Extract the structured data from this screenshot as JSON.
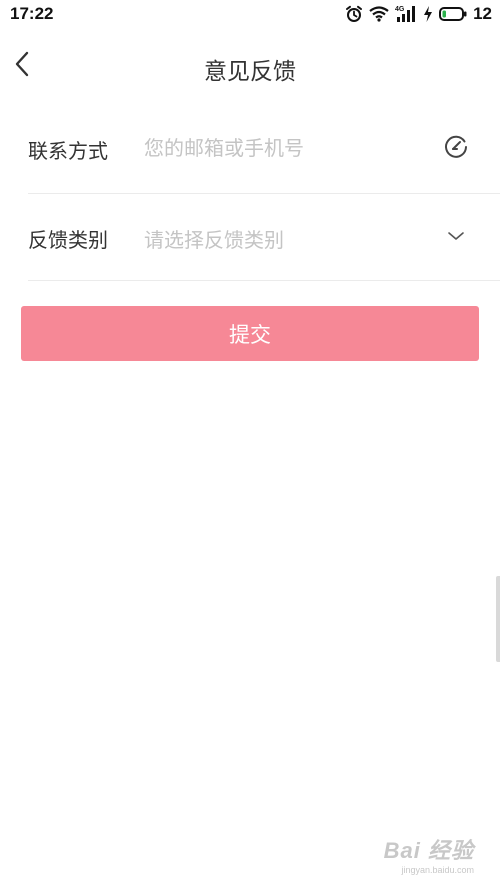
{
  "status_bar": {
    "time": "17:22",
    "battery_level": "12",
    "icons": [
      "alarm-icon",
      "wifi-icon",
      "signal-4g-icon",
      "charging-icon",
      "battery-icon"
    ]
  },
  "header": {
    "title": "意见反馈",
    "back_icon": "chevron-left-icon"
  },
  "form": {
    "contact": {
      "label": "联系方式",
      "placeholder": "您的邮箱或手机号",
      "value": "",
      "icon": "edit-icon"
    },
    "category": {
      "label": "反馈类别",
      "placeholder": "请选择反馈类别",
      "icon": "chevron-down-icon"
    }
  },
  "submit": {
    "label": "提交"
  },
  "watermark": {
    "logo": "Bai 经验",
    "url": "jingyan.baidu.com"
  },
  "colors": {
    "accent": "#f68896",
    "text": "#333333",
    "placeholder": "#c4c4c4",
    "divider": "#ebebeb"
  }
}
